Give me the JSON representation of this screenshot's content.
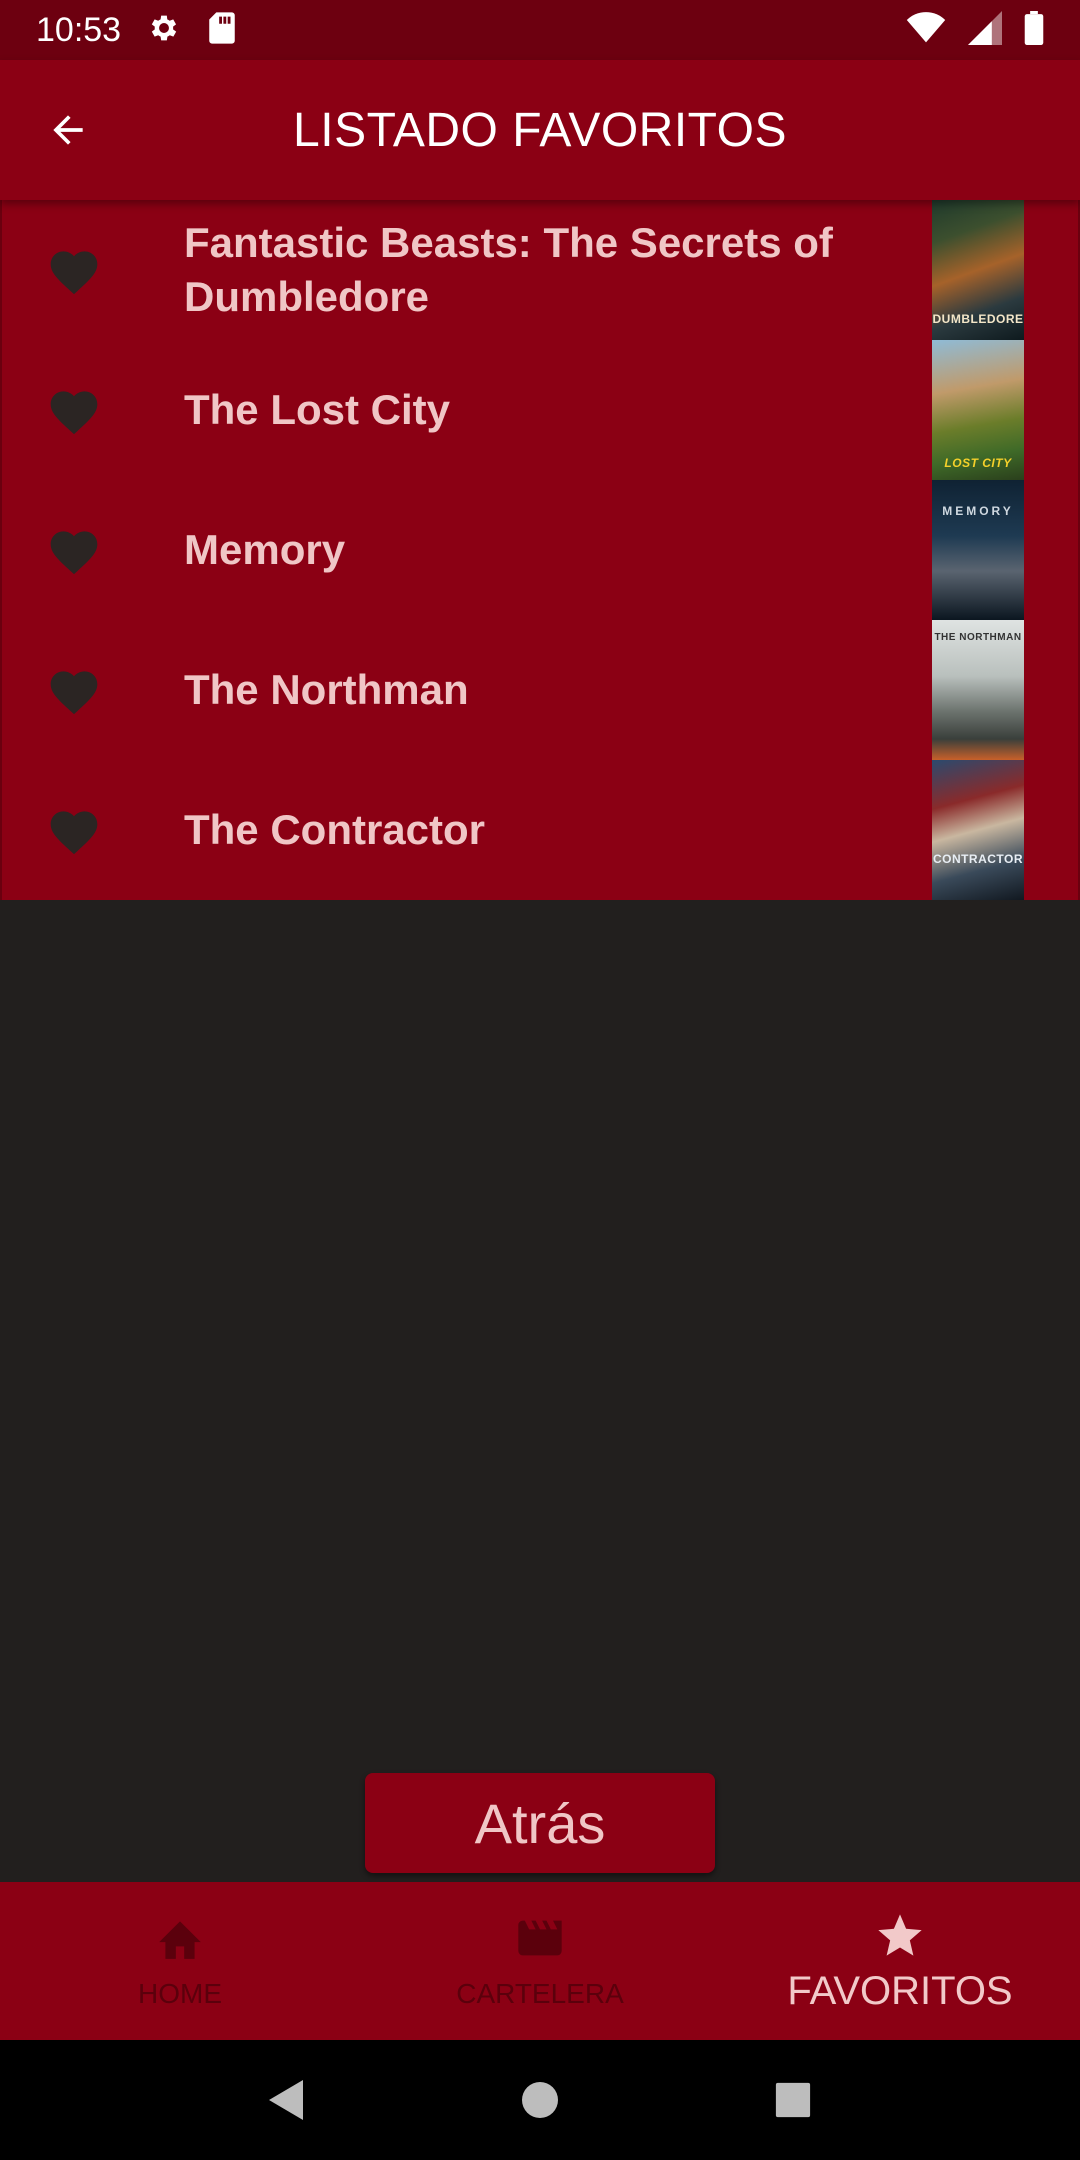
{
  "status_bar": {
    "time": "10:53",
    "icons": [
      "settings-icon",
      "sd-card-icon",
      "wifi-icon",
      "signal-icon",
      "battery-icon"
    ]
  },
  "app_bar": {
    "title": "LISTADO FAVORITOS",
    "back_icon": "arrow-back-icon"
  },
  "favorites": [
    {
      "title": "Fantastic Beasts: The Secrets of Dumbledore",
      "poster_text": "DUMBLEDORE"
    },
    {
      "title": "The Lost City",
      "poster_text": "LOST CITY"
    },
    {
      "title": "Memory",
      "poster_text": "MEMORY"
    },
    {
      "title": "The Northman",
      "poster_text": "THE NORTHMAN"
    },
    {
      "title": "The Contractor",
      "poster_text": "CONTRACTOR"
    }
  ],
  "atras_button": {
    "label": "Atrás"
  },
  "bottom_nav": {
    "items": [
      {
        "label": "HOME",
        "icon": "home-icon"
      },
      {
        "label": "CARTELERA",
        "icon": "clapperboard-icon"
      },
      {
        "label": "FAVORITOS",
        "icon": "star-icon"
      }
    ],
    "active": "FAVORITOS"
  },
  "colors": {
    "primary": "#8b0014",
    "primary_dark": "#6d0010",
    "background": "#221f1e",
    "title_text": "#f0c6c6",
    "heart": "#2b2523"
  }
}
